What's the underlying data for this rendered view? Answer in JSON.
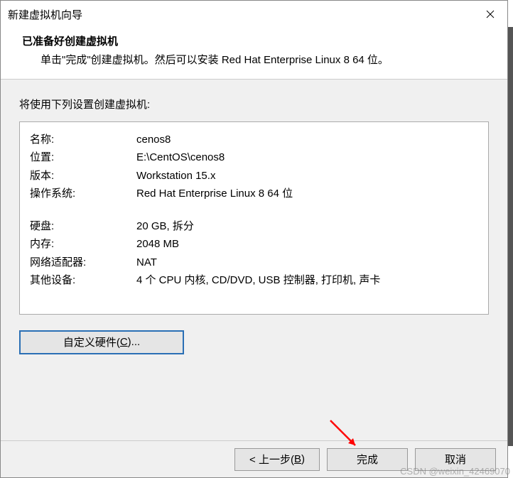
{
  "titlebar": {
    "title": "新建虚拟机向导"
  },
  "header": {
    "heading": "已准备好创建虚拟机",
    "sub": "单击\"完成\"创建虚拟机。然后可以安装 Red Hat Enterprise Linux 8 64 位。"
  },
  "content": {
    "intro": "将使用下列设置创建虚拟机:",
    "rows1": [
      {
        "label": "名称:",
        "value": "cenos8"
      },
      {
        "label": "位置:",
        "value": "E:\\CentOS\\cenos8"
      },
      {
        "label": "版本:",
        "value": "Workstation 15.x"
      },
      {
        "label": "操作系统:",
        "value": "Red Hat Enterprise Linux 8 64 位"
      }
    ],
    "rows2": [
      {
        "label": "硬盘:",
        "value": "20 GB, 拆分"
      },
      {
        "label": "内存:",
        "value": "2048 MB"
      },
      {
        "label": "网络适配器:",
        "value": "NAT"
      },
      {
        "label": "其他设备:",
        "value": "4 个 CPU 内核, CD/DVD, USB 控制器, 打印机, 声卡"
      }
    ],
    "customize_prefix": "自定义硬件(",
    "customize_key": "C",
    "customize_suffix": ")..."
  },
  "footer": {
    "back_prefix": "< 上一步(",
    "back_key": "B",
    "back_suffix": ")",
    "finish": "完成",
    "cancel": "取消"
  },
  "watermark": "CSDN @weixin_42469070"
}
